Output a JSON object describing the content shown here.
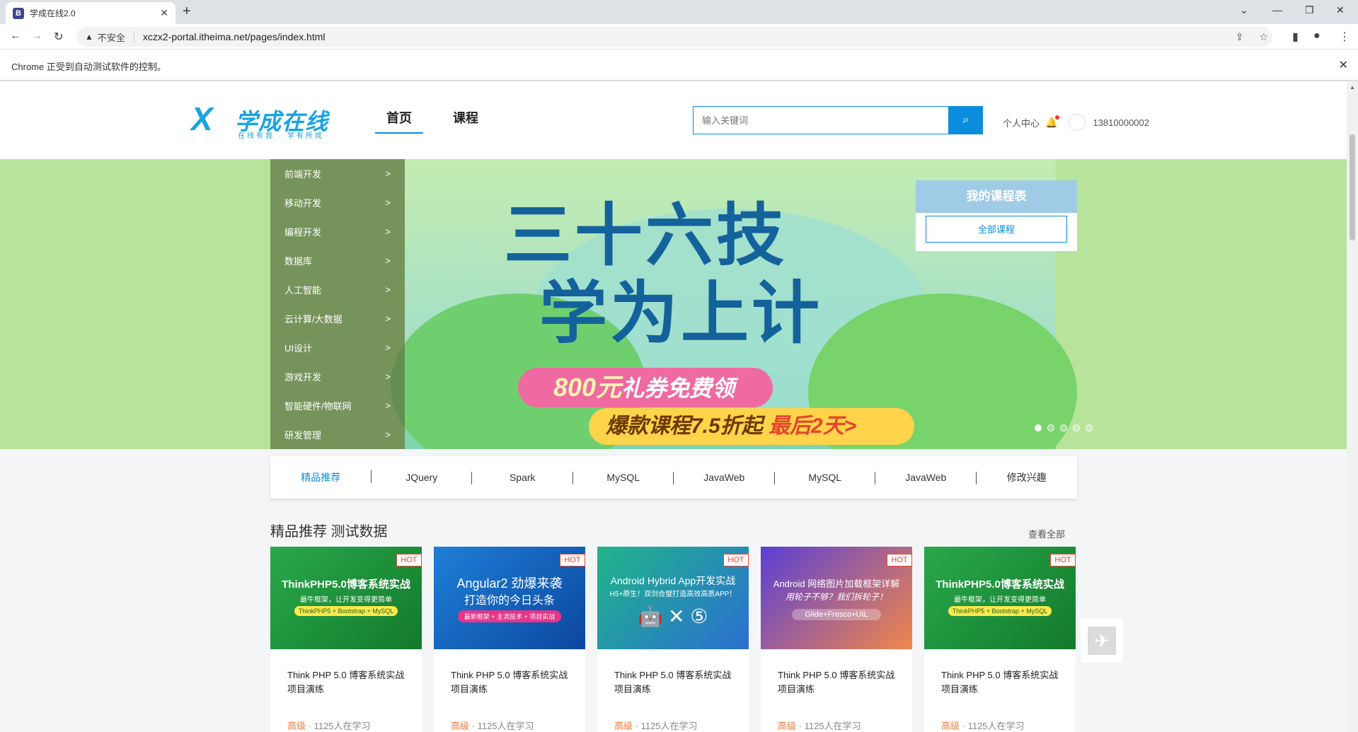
{
  "browser": {
    "tab_title": "学成在线2.0",
    "favicon_letter": "B",
    "insecure_label": "不安全",
    "url": "xczx2-portal.itheima.net/pages/index.html",
    "automation_notice": "Chrome 正受到自动测试软件的控制。"
  },
  "header": {
    "logo_mark": "X",
    "logo_name": "学成在线",
    "logo_slogan": "在线有我 · 学有所成",
    "nav": [
      "首页",
      "课程"
    ],
    "search_placeholder": "输入关键词",
    "personal_center": "个人中心",
    "phone": "13810000002"
  },
  "banner": {
    "headline_line1": "三十六技",
    "headline_line2": "学为上计",
    "promo_amount": "800元",
    "promo_text": "礼券免费领",
    "promo2_text": "爆款课程7.5折起",
    "promo2_hot": "最后2天>",
    "categories": [
      "前端开发",
      "移动开发",
      "编程开发",
      "数据库",
      "人工智能",
      "云计算/大数据",
      "UI设计",
      "游戏开发",
      "智能硬件/物联网",
      "研发管理"
    ],
    "my_courses_title": "我的课程表",
    "all_courses": "全部课程"
  },
  "subnav": [
    "精品推荐",
    "JQuery",
    "Spark",
    "MySQL",
    "JavaWeb",
    "MySQL",
    "JavaWeb",
    "修改兴趣"
  ],
  "section": {
    "title": "精品推荐 测试数据",
    "view_all": "查看全部"
  },
  "cards": [
    {
      "hot": "HOT",
      "img_title": "ThinkPHP5.0博客系统实战",
      "img_sub": "最牛框架，让开发变得更简单",
      "img_tag": "ThinkPHP5 + Bootstrap + MySQL",
      "title": "Think PHP 5.0 博客系统实战项目演练",
      "level": "高级",
      "learners": " · 1125人在学习",
      "bg": "#1f9b3a"
    },
    {
      "hot": "HOT",
      "img_title": "Angular2 劲爆来袭",
      "img_sub": "打造你的今日头条",
      "img_tag": "最新框架 + 主流技术 + 项目实战",
      "title": "Think PHP 5.0 博客系统实战项目演练",
      "level": "高级",
      "learners": " · 1125人在学习",
      "bg": "#1566c0"
    },
    {
      "hot": "HOT",
      "img_title": "Android Hybrid App开发实战",
      "img_sub": "H5+原生！双剑合璧打造高效高质APP！",
      "img_tag": "",
      "title": "Think PHP 5.0 博客系统实战项目演练",
      "level": "高级",
      "learners": " · 1125人在学习",
      "bg": "#1aa7a4"
    },
    {
      "hot": "HOT",
      "img_title": "Android 网络图片加载框架详解",
      "img_sub": "用轮子不够？我们拆轮子！",
      "img_tag": "Glide+Fresco+UIL",
      "title": "Think PHP 5.0 博客系统实战项目演练",
      "level": "高级",
      "learners": " · 1125人在学习",
      "bg": "#6a4fd1"
    },
    {
      "hot": "HOT",
      "img_title": "ThinkPHP5.0博客系统实战",
      "img_sub": "最牛框架，让开发变得更简单",
      "img_tag": "ThinkPHP5 + Bootstrap + MySQL",
      "title": "Think PHP 5.0 博客系统实战项目演练",
      "level": "高级",
      "learners": " · 1125人在学习",
      "bg": "#1f9b3a"
    }
  ]
}
